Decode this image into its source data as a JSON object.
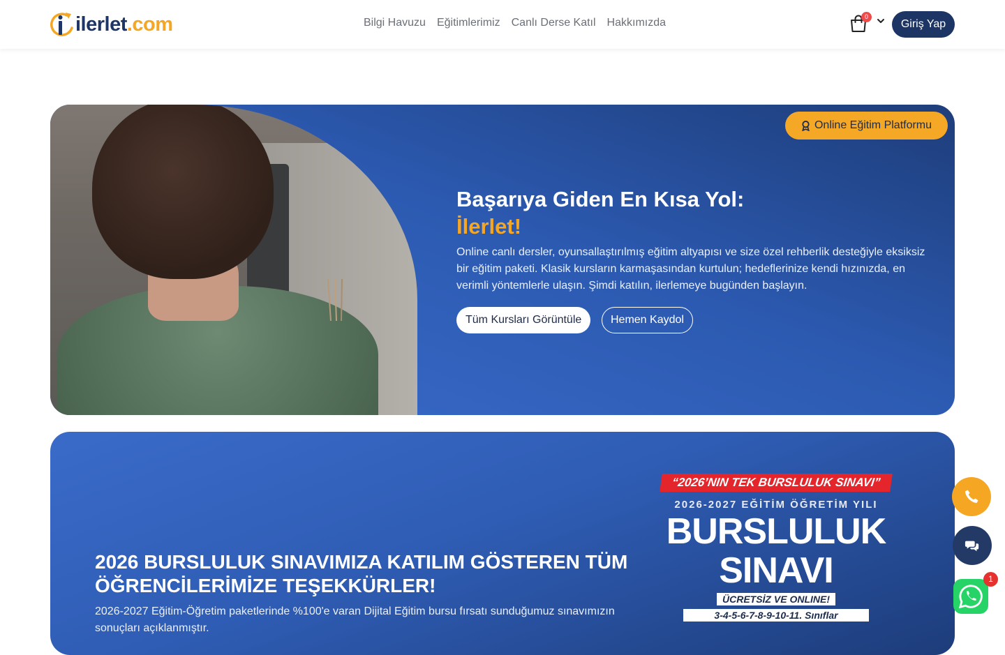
{
  "header": {
    "logo_main": "ilerlet",
    "logo_tld": ".com",
    "nav": [
      "Bilgi Havuzu",
      "Eğitimlerimiz",
      "Canlı Derse Katıl",
      "Hakkımızda"
    ],
    "cart_count": "0",
    "login_label": "Giriş Yap"
  },
  "hero": {
    "badge": "Online Eğitim Platformu",
    "title_line1": "Başarıya Giden En Kısa Yol:",
    "title_accent": "İlerlet!",
    "description": "Online canlı dersler, oyunsallaştırılmış eğitim altyapısı ve size özel rehberlik desteğiyle eksiksiz bir eğitim paketi. Klasik kursların karmaşasından kurtulun; hedeflerinize kendi hızınızda, en verimli yöntemlerle ulaşın. Şimdi katılın, ilerlemeye bugünden başlayın.",
    "primary_button": "Tüm Kursları Görüntüle",
    "secondary_button": "Hemen Kaydol"
  },
  "scholarship": {
    "title": "2026 BURSLULUK SINAVIMIZA KATILIM GÖSTEREN TÜM ÖĞRENCİLERİMİZE TEŞEKKÜRLER!",
    "description": "2026-2027 Eğitim-Öğretim paketlerinde %100'e varan Dijital Eğitim bursu fırsatı sunduğumuz sınavımızın sonuçları açıklanmıştır.",
    "poster": {
      "ribbon": "“2026’NIN TEK BURSLULUK SINAVI”",
      "subtitle": "2026-2027 EĞİTİM ÖĞRETİM YILI",
      "big_line1": "BURSLULUK",
      "big_line2": "SINAVI",
      "free": "ÜCRETSİZ VE ONLINE!",
      "classes": "3-4-5-6-7-8-9-10-11. Sınıflar"
    }
  },
  "floating": {
    "whatsapp_badge": "1"
  },
  "colors": {
    "brand_navy": "#1c3564",
    "brand_orange": "#f5a623",
    "hero_blue": "#2c5ab1",
    "whatsapp_green": "#25d366"
  }
}
